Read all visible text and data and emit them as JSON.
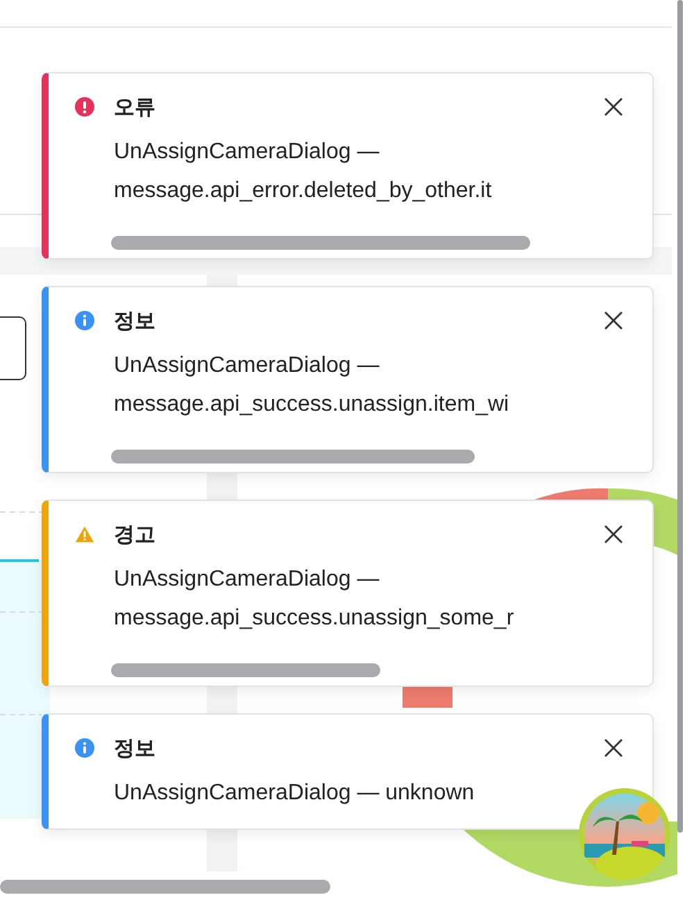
{
  "toasts": [
    {
      "kind": "error",
      "title": "오류",
      "lines": [
        "UnAssignCameraDialog —",
        "message.api_error.deleted_by_other.it"
      ],
      "progress": true
    },
    {
      "kind": "info",
      "title": "정보",
      "lines": [
        "UnAssignCameraDialog —",
        "message.api_success.unassign.item_wi"
      ],
      "progress": true
    },
    {
      "kind": "warning",
      "title": "경고",
      "lines": [
        "UnAssignCameraDialog —",
        "message.api_success.unassign_some_r"
      ],
      "progress": true
    },
    {
      "kind": "info",
      "title": "정보",
      "lines": [
        "UnAssignCameraDialog — unknown"
      ],
      "progress": false
    }
  ]
}
